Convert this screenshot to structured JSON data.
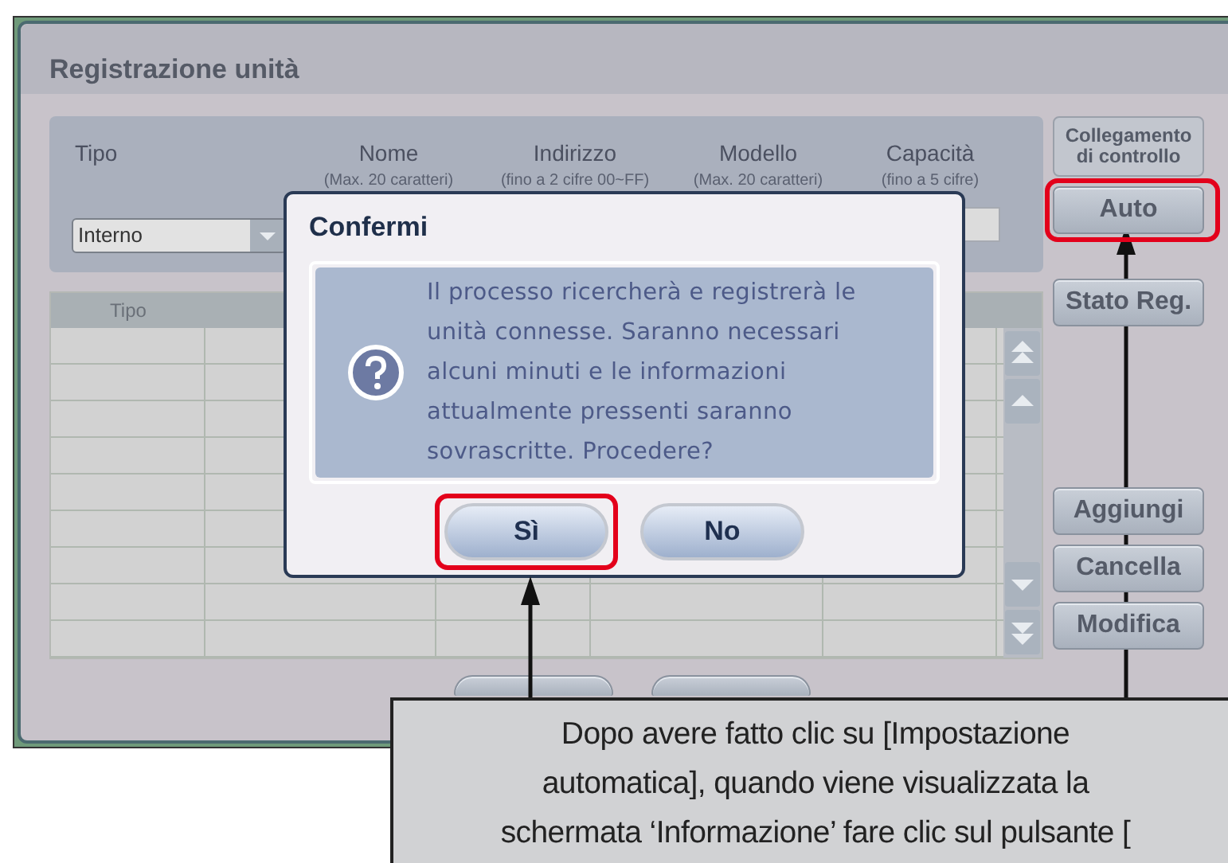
{
  "window": {
    "title": "Registrazione unità"
  },
  "form": {
    "fields": [
      {
        "label": "Tipo"
      },
      {
        "label": "Nome",
        "hint": "(Max. 20 caratteri)"
      },
      {
        "label": "Indirizzo",
        "hint": "(fino a 2 cifre 00~FF)"
      },
      {
        "label": "Modello",
        "hint": "(Max. 20 caratteri)"
      },
      {
        "label": "Capacità",
        "hint": "(fino a 5 cifre)"
      }
    ],
    "type_select": {
      "value": "Interno"
    }
  },
  "side_buttons": [
    {
      "label": "Collegamento di controllo",
      "kind": "header",
      "highlighted": false
    },
    {
      "label": "Auto",
      "kind": "button",
      "highlighted": true
    },
    {
      "label": "Stato Reg.",
      "kind": "button",
      "highlighted": false
    },
    {
      "label": "Aggiungi",
      "kind": "button",
      "highlighted": false
    },
    {
      "label": "Cancella",
      "kind": "button",
      "highlighted": false
    },
    {
      "label": "Modifica",
      "kind": "button",
      "highlighted": false
    }
  ],
  "table": {
    "columns": [
      "Tipo"
    ]
  },
  "dialog": {
    "title": "Confermi",
    "message": "Il processo ricercherà e registrerà le unità connesse. Saranno necessari alcuni minuti e le informazioni attualmente pressenti saranno sovrascritte. Procedere?",
    "buttons": [
      {
        "label": "Sì",
        "highlighted": true
      },
      {
        "label": "No",
        "highlighted": false
      }
    ]
  },
  "callout": {
    "text": "Dopo avere fatto clic su [Impostazione\nautomatica], quando viene visualizzata la\nschermata ‘Informazione’ fare clic sul pulsante ["
  }
}
